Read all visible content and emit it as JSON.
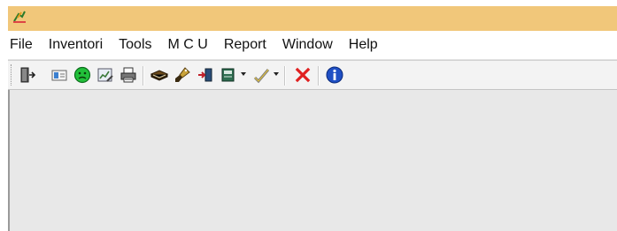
{
  "window": {
    "title": ""
  },
  "menu": {
    "items": [
      {
        "label": "File"
      },
      {
        "label": "Inventori"
      },
      {
        "label": "Tools"
      },
      {
        "label": "M C U"
      },
      {
        "label": "Report"
      },
      {
        "label": "Window"
      },
      {
        "label": "Help"
      }
    ]
  },
  "toolbar": {
    "buttons": [
      {
        "icon": "exit-door-icon"
      },
      {
        "icon": "card-icon"
      },
      {
        "icon": "green-smiley-icon"
      },
      {
        "icon": "chart-edit-icon"
      },
      {
        "icon": "printer-icon"
      },
      {
        "icon": "book-icon"
      },
      {
        "icon": "brush-icon"
      },
      {
        "icon": "login-icon"
      },
      {
        "icon": "notebook-dropdown-icon"
      },
      {
        "icon": "checklist-dropdown-icon"
      },
      {
        "icon": "close-x-icon"
      },
      {
        "icon": "info-icon"
      }
    ]
  },
  "colors": {
    "titlebar": "#f1c77a",
    "client_background": "#e8e8e8",
    "close_red": "#e02020",
    "info_blue": "#1f4fc4",
    "smiley_green": "#22c03a"
  }
}
